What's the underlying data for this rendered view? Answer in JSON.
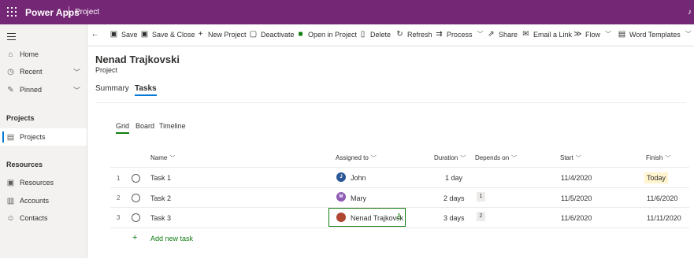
{
  "topbar": {
    "app_name": "Power Apps",
    "area": "Project",
    "right_glyph": "♪"
  },
  "colors": {
    "brand": "#742774",
    "accent": "#0078d4",
    "green": "#107c10",
    "today_bg": "#fff4ce"
  },
  "nav": {
    "items": [
      {
        "label": "Home",
        "icon": "home-icon"
      },
      {
        "label": "Recent",
        "icon": "clock-icon"
      },
      {
        "label": "Pinned",
        "icon": "pin-icon"
      }
    ],
    "section_projects": "Projects",
    "projects_item": "Projects",
    "section_resources": "Resources",
    "resource_items": [
      {
        "label": "Resources",
        "icon": "resources-icon"
      },
      {
        "label": "Accounts",
        "icon": "accounts-icon"
      },
      {
        "label": "Contacts",
        "icon": "contacts-icon"
      }
    ]
  },
  "commands": [
    {
      "label": "Save",
      "icon": "save-icon"
    },
    {
      "label": "Save & Close",
      "icon": "save-close-icon"
    },
    {
      "label": "New Project",
      "icon": "plus-icon"
    },
    {
      "label": "Deactivate",
      "icon": "deactivate-icon"
    },
    {
      "label": "Open in Project",
      "icon": "project-icon"
    },
    {
      "label": "Delete",
      "icon": "trash-icon"
    },
    {
      "label": "Refresh",
      "icon": "refresh-icon"
    },
    {
      "label": "Process",
      "icon": "process-icon"
    },
    {
      "label": "Share",
      "icon": "share-icon"
    },
    {
      "label": "Email a Link",
      "icon": "mail-icon"
    },
    {
      "label": "Flow",
      "icon": "flow-icon"
    },
    {
      "label": "Word Templates",
      "icon": "word-icon"
    }
  ],
  "record": {
    "name": "Nenad Trajkovski",
    "entity": "Project"
  },
  "tabs": [
    "Summary",
    "Tasks"
  ],
  "view_tabs": [
    "Grid",
    "Board",
    "Timeline"
  ],
  "grid": {
    "columns": [
      "Name",
      "Assigned to",
      "Duration",
      "Depends on",
      "Start",
      "Finish"
    ],
    "rows": [
      {
        "num": "1",
        "name": "Task 1",
        "initial": "J",
        "assigned": "John",
        "duration": "1 day",
        "depends": "",
        "start": "11/4/2020",
        "finish": "Today",
        "avatar_color": "#2b5797"
      },
      {
        "num": "2",
        "name": "Task 2",
        "initial": "M",
        "assigned": "Mary",
        "duration": "2 days",
        "depends": "1",
        "start": "11/5/2020",
        "finish": "11/6/2020",
        "avatar_color": "#8e5ab5"
      },
      {
        "num": "3",
        "name": "Task 3",
        "initial": "",
        "assigned": "Nenad Trajkovsk",
        "duration": "3 days",
        "depends": "2",
        "start": "11/6/2020",
        "finish": "11/11/2020",
        "avatar_color": "#b04632"
      }
    ],
    "add_task": "Add new task"
  }
}
